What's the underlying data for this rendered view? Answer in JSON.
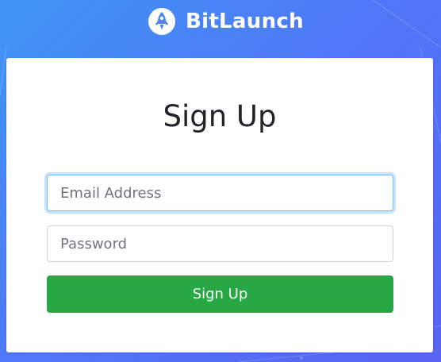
{
  "brand": {
    "name": "BitLaunch",
    "logo_icon": "rocket-icon"
  },
  "form": {
    "title": "Sign Up",
    "email": {
      "placeholder": "Email Address",
      "value": ""
    },
    "password": {
      "placeholder": "Password",
      "value": ""
    },
    "submit_label": "Sign Up"
  },
  "colors": {
    "background_start": "#3f96f5",
    "background_end": "#5a63f3",
    "card": "#ffffff",
    "submit_button": "#28a745",
    "focus_border": "#80bdff"
  }
}
